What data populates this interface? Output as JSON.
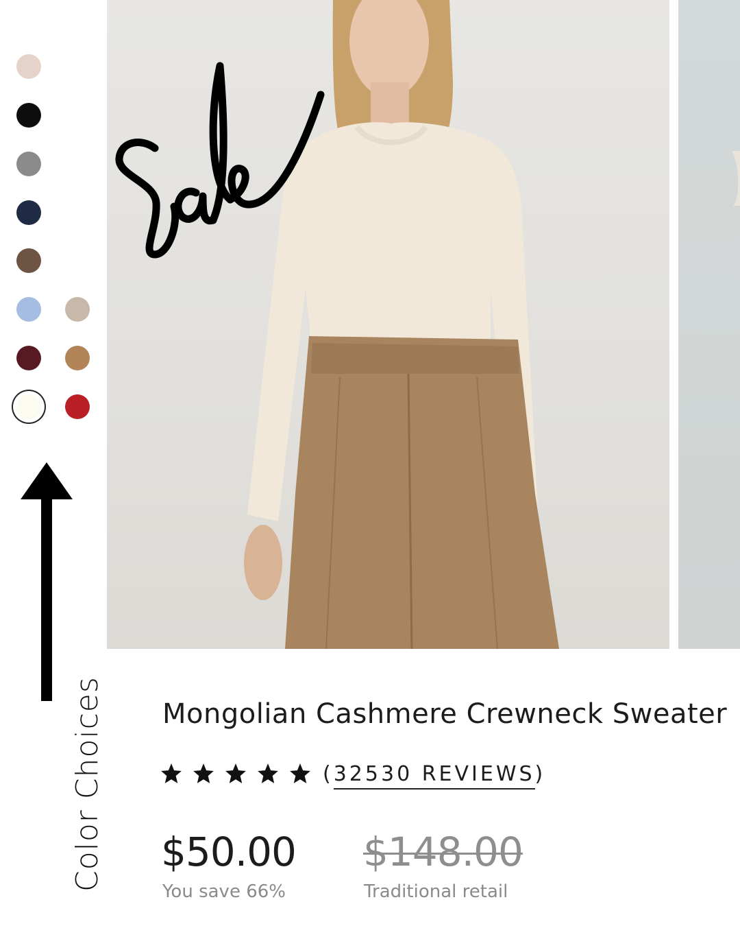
{
  "colors": {
    "swatches": [
      {
        "name": "swatch-blush",
        "hex": "#e5d3c9"
      },
      {
        "name": "swatch-black",
        "hex": "#0d0d0d"
      },
      {
        "name": "swatch-grey",
        "hex": "#8a8a8a"
      },
      {
        "name": "swatch-navy",
        "hex": "#1f2a44"
      },
      {
        "name": "swatch-brown",
        "hex": "#6e5443"
      },
      {
        "name": "swatch-light-blue",
        "hex": "#a4bde0"
      },
      {
        "name": "swatch-oatmeal",
        "hex": "#c8b8aa"
      },
      {
        "name": "swatch-burgundy",
        "hex": "#581a22"
      },
      {
        "name": "swatch-camel",
        "hex": "#b28458"
      },
      {
        "name": "swatch-ivory",
        "hex": "#fbfbef",
        "selected": true
      },
      {
        "name": "swatch-red",
        "hex": "#b91f24"
      }
    ],
    "label": "Color Choices"
  },
  "banner": {
    "sale_text": "Sale"
  },
  "product": {
    "title": "Mongolian Cashmere Crewneck Sweater",
    "rating_stars": 5,
    "reviews_open": "(",
    "reviews_link": "32530 REVIEWS",
    "reviews_close": ")",
    "price": "$50.00",
    "save_note": "You save 66%",
    "old_price": "$148.00",
    "retail_note": "Traditional retail"
  }
}
